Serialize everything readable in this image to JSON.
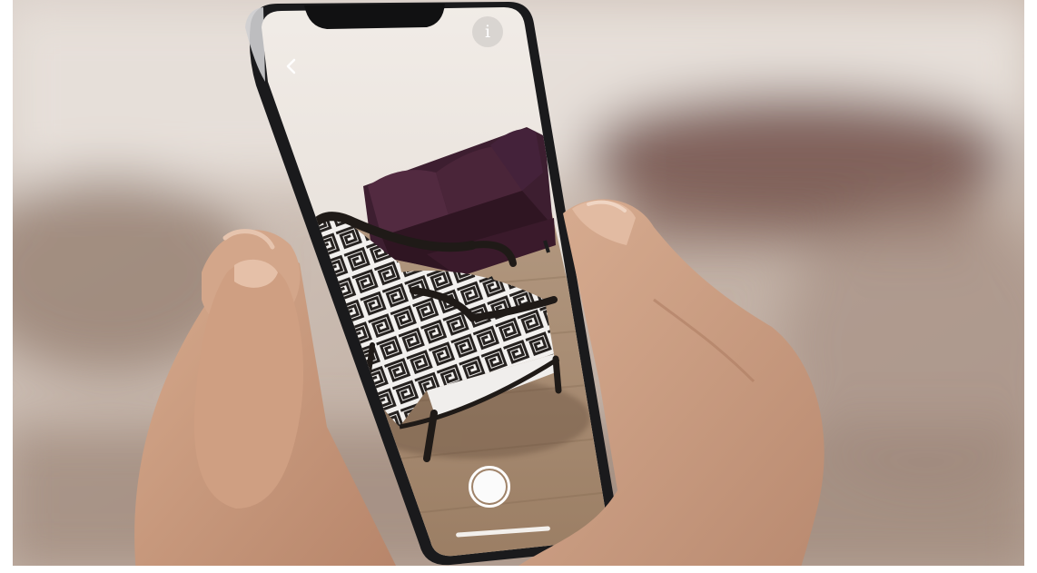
{
  "scene": {
    "subject": "hands-holding-smartphone-ar-furniture",
    "colors": {
      "background_warm": "#c9b9ae",
      "sofa": "#3b1d2e",
      "chair_frame": "#1f1a17",
      "floor_wood": "#a88b70",
      "wall": "#e9e2db",
      "skin": "#c99a7c",
      "phone_frame": "#1a1a1c"
    }
  },
  "app": {
    "back_icon": "chevron-left-icon",
    "info_icon": "info-icon",
    "info_glyph": "i",
    "shutter_icon": "shutter-icon"
  }
}
